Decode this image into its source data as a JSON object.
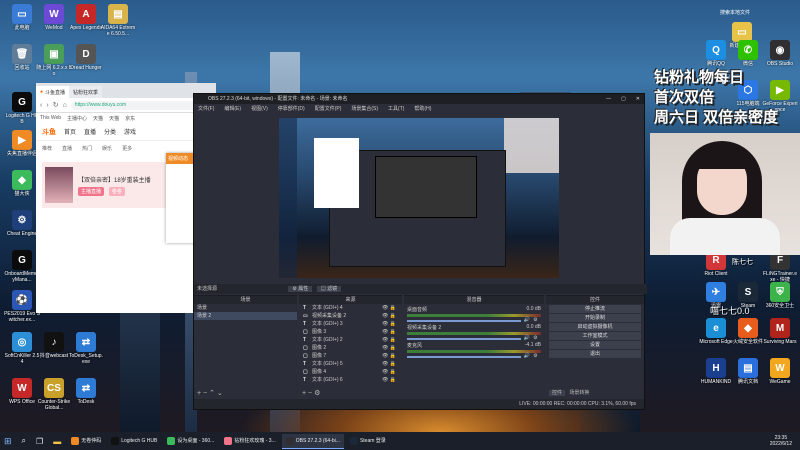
{
  "desktop": {
    "left_icons": [
      {
        "label": "此电脑",
        "color": "#3a7bd5",
        "glyph": "▭"
      },
      {
        "label": "WeMod",
        "color": "#6d4ad6",
        "glyph": "W"
      },
      {
        "label": "Apex Legends",
        "color": "#c62828",
        "glyph": "A"
      },
      {
        "label": "AIDA64 Extreme 6.50.5...",
        "color": "#d9b44a",
        "glyph": "▤"
      },
      {
        "label": "回收站",
        "color": "#5f7d99",
        "glyph": "🗑"
      },
      {
        "label": "随上网 6.2.x.x bo",
        "color": "#4a9e5a",
        "glyph": "▣"
      },
      {
        "label": "Dread Hunger",
        "color": "#555",
        "glyph": "D"
      },
      {
        "label": "Logitech G HUB",
        "color": "#0b0b0b",
        "glyph": "G"
      },
      {
        "label": "失焦直播伴侣",
        "color": "#f08a24",
        "glyph": "▶"
      },
      {
        "label": "猫大侠",
        "color": "#3cbb5d",
        "glyph": "◆"
      },
      {
        "label": "Cheat Engine",
        "color": "#1e3f7a",
        "glyph": "⚙"
      },
      {
        "label": "OnboardMemoryMana...",
        "color": "#0b0b0b",
        "glyph": "G"
      },
      {
        "label": "PES2019 Evo Switcher.ex...",
        "color": "#2a56b5",
        "glyph": "⚽"
      },
      {
        "label": "SoftCnKiller 2.54",
        "color": "#2c8fd6",
        "glyph": "◎"
      },
      {
        "label": "抖音webcast",
        "color": "#111",
        "glyph": "♪"
      },
      {
        "label": "ToDesk_Setup.exe",
        "color": "#2e7bd6",
        "glyph": "⇄"
      },
      {
        "label": "WPS Office",
        "color": "#c62828",
        "glyph": "W"
      },
      {
        "label": "Counter-Strike Global...",
        "color": "#c9a12a",
        "glyph": "CS"
      },
      {
        "label": "ToDesk",
        "color": "#2e7bd6",
        "glyph": "⇄"
      }
    ],
    "right_icons": [
      {
        "label": "新建文件夹",
        "color": "#e8c349",
        "glyph": "▭"
      },
      {
        "label": "腾讯QQ",
        "color": "#1d8fe3",
        "glyph": "Q"
      },
      {
        "label": "微信",
        "color": "#2dc100",
        "glyph": "✆"
      },
      {
        "label": "OBS Studio",
        "color": "#302e31",
        "glyph": "◉"
      },
      {
        "label": "115电脑端",
        "color": "#2b78e4",
        "glyph": "⬡"
      },
      {
        "label": "GeForce Experience",
        "color": "#76b900",
        "glyph": "▶"
      },
      {
        "label": "Riot Client",
        "color": "#d13639",
        "glyph": "R"
      },
      {
        "label": "FLiNGTrainer.exe - 快捷",
        "color": "#333",
        "glyph": "F"
      },
      {
        "label": "迅雷",
        "color": "#2f7fe0",
        "glyph": "✈"
      },
      {
        "label": "Steam",
        "color": "#1b2838",
        "glyph": "S"
      },
      {
        "label": "360安全卫士",
        "color": "#3cb34a",
        "glyph": "⛨"
      },
      {
        "label": "Microsoft Edge",
        "color": "#1a8fd6",
        "glyph": "e"
      },
      {
        "label": "火绒安全软件",
        "color": "#e85d1c",
        "glyph": "◆"
      },
      {
        "label": "Surviving Mars",
        "color": "#b0241c",
        "glyph": "M"
      },
      {
        "label": "HUMANKIND",
        "color": "#1b3f8f",
        "glyph": "H"
      },
      {
        "label": "腾讯文档",
        "color": "#2a6fdb",
        "glyph": "▤"
      },
      {
        "label": "WeGame",
        "color": "#f2a71e",
        "glyph": "W"
      }
    ],
    "search_label": "搜索本地文件"
  },
  "browser": {
    "tab_title": "斗鱼直播",
    "tab2_title": "钻粉狂欢季",
    "url": "https://www.douyu.com",
    "bookmarks": [
      "This Web",
      "主播中心",
      "天猫",
      "天猫",
      "京东"
    ],
    "site_nav": [
      "首页",
      "直播",
      "分类",
      "游戏"
    ],
    "categories": [
      "推荐",
      "直播",
      "热门",
      "娱乐",
      "更多"
    ],
    "card_title": "【双倍亲密】18岁重装主播",
    "card_buttons": [
      "主播直播",
      "卷卷"
    ],
    "floating_label": "视频动态"
  },
  "obs": {
    "title": "OBS 27.2.3 (64-bit, windows) - 配置文件: 未命名 - 场景: 未命名",
    "menu": [
      "文件(F)",
      "编辑(E)",
      "视图(V)",
      "停靠部件(D)",
      "配置文件(P)",
      "场景集合(S)",
      "工具(T)",
      "帮助(H)"
    ],
    "source_label": "未选择源",
    "prop_buttons": [
      "属性",
      "滤镜"
    ],
    "docks": {
      "scenes": {
        "title": "场景",
        "items": [
          "场景",
          "场景 2"
        ]
      },
      "sources": {
        "title": "来源",
        "items": [
          {
            "type": "T",
            "name": "文本 (GDI+) 4"
          },
          {
            "type": "▭",
            "name": "视频采集设备 2"
          },
          {
            "type": "T",
            "name": "文本 (GDI+) 3"
          },
          {
            "type": "▢",
            "name": "图像 3"
          },
          {
            "type": "T",
            "name": "文本 (GDI+) 2"
          },
          {
            "type": "▢",
            "name": "图像 2"
          },
          {
            "type": "▢",
            "name": "图像 7"
          },
          {
            "type": "T",
            "name": "文本 (GDI+) 5"
          },
          {
            "type": "▢",
            "name": "图像 4"
          },
          {
            "type": "T",
            "name": "文本 (GDI+) 6"
          }
        ]
      },
      "mixer": {
        "title": "混音器",
        "channels": [
          {
            "name": "桌面音频",
            "db": "0.0 dB"
          },
          {
            "name": "视频采集设备 2",
            "db": "0.0 dB"
          },
          {
            "name": "麦克风",
            "db": "-4.1 dB"
          }
        ]
      },
      "controls": {
        "title": "控件",
        "buttons": [
          "停止推流",
          "开始录制",
          "启动虚拟摄像机",
          "工作室模式",
          "设置",
          "退出"
        ],
        "tab_labels": [
          "控件",
          "场景转换"
        ]
      }
    },
    "status": "LIVE: 00:00:00   REC: 00:00:00   CPU: 3.1%, 60.00 fps"
  },
  "overlay": {
    "promo_lines": [
      "钻粉礼物每日",
      "首次双倍",
      "周六日 双倍亲密度"
    ],
    "sign_text": "陈七七",
    "caption": "喵七七0.0"
  },
  "taskbar": {
    "items": [
      "无卷仲码",
      "Logitech G HUB",
      "设为桌面 - 360...",
      "钻粉狂欢玫瑰 - 3...",
      "OBS 27.2.3 (64-bi...",
      "Steam 登录"
    ],
    "time": "23:35",
    "date": "2022/6/12"
  }
}
